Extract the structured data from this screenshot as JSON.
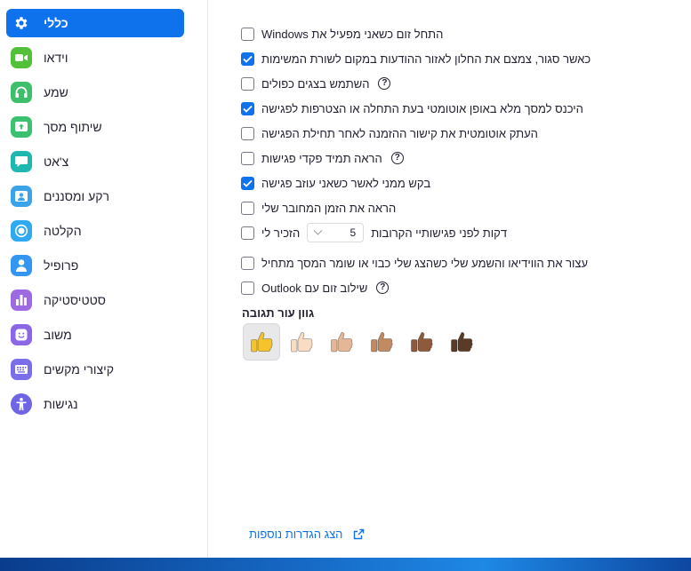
{
  "sidebar": {
    "items": [
      {
        "label": "כללי",
        "icon": "gear-icon",
        "color": "#0e72ed",
        "active": true
      },
      {
        "label": "וידאו",
        "icon": "video-camera-icon",
        "color": "#52c13a",
        "active": false
      },
      {
        "label": "שמע",
        "icon": "headphones-icon",
        "color": "#3fbf6b",
        "active": false
      },
      {
        "label": "שיתוף מסך",
        "icon": "share-screen-icon",
        "color": "#3bc16f",
        "active": false
      },
      {
        "label": "צ'אט",
        "icon": "chat-bubble-icon",
        "color": "#1fb8b0",
        "active": false
      },
      {
        "label": "רקע ומסננים",
        "icon": "portrait-icon",
        "color": "#3ba3e8",
        "active": false
      },
      {
        "label": "הקלטה",
        "icon": "record-icon",
        "color": "#2fa9ef",
        "active": false
      },
      {
        "label": "פרופיל",
        "icon": "person-icon",
        "color": "#3396f0",
        "active": false
      },
      {
        "label": "סטטיסטיקה",
        "icon": "bar-chart-icon",
        "color": "#9e6ae4",
        "active": false
      },
      {
        "label": "משוב",
        "icon": "smiley-icon",
        "color": "#8b67e6",
        "active": false
      },
      {
        "label": "קיצורי מקשים",
        "icon": "keyboard-icon",
        "color": "#7a6fe8",
        "active": false
      },
      {
        "label": "נגישות",
        "icon": "accessibility-icon",
        "color": "#6f64e4",
        "active": false
      }
    ]
  },
  "settings": {
    "start_with_windows": {
      "label": "התחל זום כשאני מפעיל את Windows",
      "checked": false
    },
    "minimize_to_tray": {
      "label": "כאשר סגור, צמצם את החלון לאזור ההודעות במקום לשורת המשימות",
      "checked": true
    },
    "dual_monitors": {
      "label": "השתמש בצגים כפולים",
      "checked": false
    },
    "auto_fullscreen": {
      "label": "היכנס למסך מלא באופן אוטומטי בעת התחלה או הצטרפות לפגישה",
      "checked": true
    },
    "copy_invite_link": {
      "label": "העתק אוטומטית את קישור ההזמנה לאחר תחילת הפגישה",
      "checked": false
    },
    "show_meeting_controls": {
      "label": "הראה תמיד פקדי פגישות",
      "checked": false
    },
    "confirm_leave": {
      "label": "בקש ממני לאשר כשאני עוזב פגישה",
      "checked": true
    },
    "show_connected_time": {
      "label": "הראה את הזמן המחובר שלי",
      "checked": false
    },
    "remind_me": {
      "label_prefix": "הזכיר לי",
      "label_suffix": "דקות לפני פגישותיי הקרובות",
      "minutes": "5",
      "checked": false
    },
    "stop_video_lock": {
      "label": "עצור את הווידיאו והשמע שלי כשהצג שלי כבוי או שומר המסך מתחיל",
      "checked": false
    },
    "outlook_integration": {
      "label": "שילוב זום עם Outlook",
      "checked": false
    }
  },
  "help_glyph": "?",
  "reaction_skin_tone": {
    "title": "גוון עור תגובה",
    "tones": [
      {
        "name": "thumbs-up-yellow",
        "color": "#f5c42c",
        "selected": true
      },
      {
        "name": "thumbs-up-light",
        "color": "#f9dcc4",
        "selected": false
      },
      {
        "name": "thumbs-up-medium-light",
        "color": "#e5b796",
        "selected": false
      },
      {
        "name": "thumbs-up-medium",
        "color": "#c08a63",
        "selected": false
      },
      {
        "name": "thumbs-up-medium-dark",
        "color": "#8d5a3c",
        "selected": false
      },
      {
        "name": "thumbs-up-dark",
        "color": "#5a3b28",
        "selected": false
      }
    ]
  },
  "footer": {
    "more_settings_label": "הצג הגדרות נוספות"
  }
}
